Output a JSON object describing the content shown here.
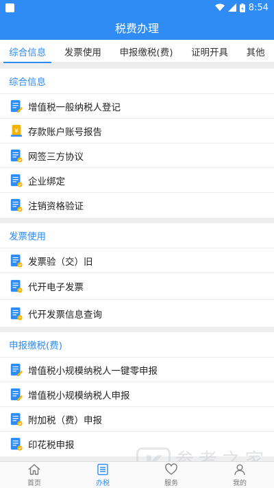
{
  "status_bar": {
    "time": "8:54"
  },
  "header": {
    "title": "税费办理"
  },
  "tabs": [
    {
      "label": "综合信息",
      "active": true
    },
    {
      "label": "发票使用",
      "active": false
    },
    {
      "label": "申报缴税(费)",
      "active": false
    },
    {
      "label": "证明开具",
      "active": false
    },
    {
      "label": "其他",
      "active": false
    }
  ],
  "sections": [
    {
      "title": "综合信息",
      "items": [
        {
          "label": "增值税一般纳税人登记",
          "icon": "edit-doc-icon"
        },
        {
          "label": "存款账户账号报告",
          "icon": "yen-doc-icon"
        },
        {
          "label": "网签三方协议",
          "icon": "check-doc-icon"
        },
        {
          "label": "企业绑定",
          "icon": "check-doc-icon"
        },
        {
          "label": "注销资格验证",
          "icon": "check-doc-icon"
        }
      ]
    },
    {
      "title": "发票使用",
      "items": [
        {
          "label": "发票验（交）旧",
          "icon": "check-doc-icon"
        },
        {
          "label": "代开电子发票",
          "icon": "clock-doc-icon"
        },
        {
          "label": "代开发票信息查询",
          "icon": "clock-doc-icon"
        }
      ]
    },
    {
      "title": "申报缴税(费)",
      "items": [
        {
          "label": "增值税小规模纳税人一键零申报",
          "icon": "edit-doc-icon"
        },
        {
          "label": "增值税小规模纳税人申报",
          "icon": "edit-doc-icon"
        },
        {
          "label": "附加税（费）申报",
          "icon": "check-doc-icon"
        },
        {
          "label": "印花税申报",
          "icon": "check-doc-icon"
        }
      ]
    }
  ],
  "bottom_nav": [
    {
      "label": "首页",
      "icon": "home-icon",
      "active": false
    },
    {
      "label": "办税",
      "icon": "list-icon",
      "active": true
    },
    {
      "label": "服务",
      "icon": "heart-icon",
      "active": false
    },
    {
      "label": "我的",
      "icon": "user-icon",
      "active": false
    }
  ],
  "watermark": {
    "text": "参考之家",
    "url": "www.ckdzb.com"
  },
  "colors": {
    "accent": "#2f8cf5",
    "badge": "#f5b400"
  }
}
